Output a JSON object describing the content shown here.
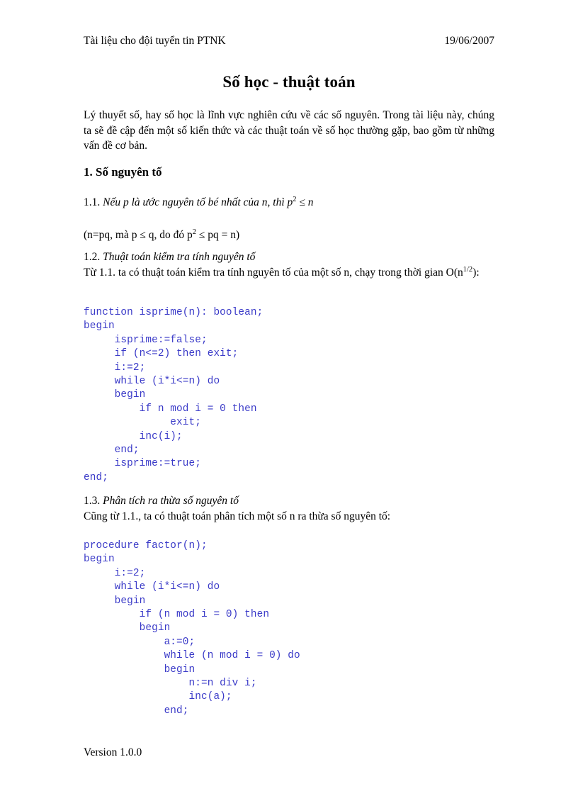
{
  "header": {
    "left": "Tài liệu cho đội tuyển tin PTNK",
    "date": "19/06/2007"
  },
  "title": "Số học - thuật toán",
  "intro": "Lý thuyết số, hay số học là lĩnh vực nghiên cứu về các số nguyên. Trong tài liệu này, chúng ta sẽ đề cập đến một số kiến thức và các thuật toán về số học thường gặp, bao gồm từ những vấn đề cơ bản.",
  "section1": {
    "heading": "1. Số nguyên tố",
    "s11": {
      "number": "1.1.",
      "title_pre": "Nếu p là ước nguyên tố bé nhất của n, thì p",
      "title_sup": "2",
      "title_post": " ≤ n",
      "note_pre": "(n=pq, mà p ≤ q, do đó p",
      "note_sup": "2",
      "note_post": " ≤ pq = n)"
    },
    "s12": {
      "number": "1.2.",
      "title": "Thuật toán kiểm tra tính nguyên tố",
      "body_pre": "Từ 1.1. ta có thuật toán kiểm tra tính nguyên tố của một số n, chạy trong thời gian O(n",
      "body_sup": "1/2",
      "body_post": "):",
      "code": "function isprime(n): boolean;\nbegin\n     isprime:=false;\n     if (n<=2) then exit;\n     i:=2;\n     while (i*i<=n) do\n     begin\n         if n mod i = 0 then\n              exit;\n         inc(i);\n     end;\n     isprime:=true;\nend;"
    },
    "s13": {
      "number": "1.3.",
      "title": "Phân tích ra thừa số nguyên tố",
      "body": "Cũng từ 1.1., ta có thuật toán phân tích một số n ra thừa số nguyên tố:",
      "code": "procedure factor(n);\nbegin\n     i:=2;\n     while (i*i<=n) do\n     begin\n         if (n mod i = 0) then\n         begin\n             a:=0;\n             while (n mod i = 0) do\n             begin\n                 n:=n div i;\n                 inc(a);\n             end;"
    }
  },
  "footer": "Version 1.0.0"
}
